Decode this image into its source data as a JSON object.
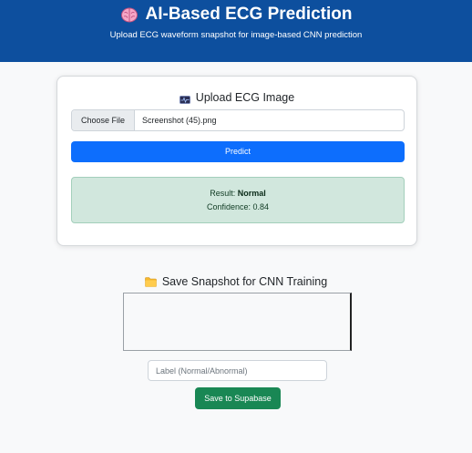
{
  "header": {
    "title": "AI-Based ECG Prediction",
    "subtitle": "Upload ECG waveform snapshot for image-based CNN prediction",
    "icon": "brain-icon",
    "background_color": "#0d4f9e"
  },
  "upload_card": {
    "title": "Upload ECG Image",
    "icon": "ecg-image-icon",
    "file_input": {
      "button_label": "Choose File",
      "file_name": "Screenshot (45).png"
    },
    "predict_label": "Predict",
    "predict_color": "#0d6efd",
    "result": {
      "result_prefix": "Result:",
      "result_value": "Normal",
      "confidence_prefix": "Confidence:",
      "confidence_value": "0.84",
      "color": "#d1e7dd"
    }
  },
  "snapshot": {
    "title": "Save Snapshot for CNN Training",
    "icon": "folder-icon",
    "label_placeholder": "Label (Normal/Abnormal)",
    "label_value": "",
    "save_label": "Save to Supabase",
    "save_color": "#198754"
  }
}
